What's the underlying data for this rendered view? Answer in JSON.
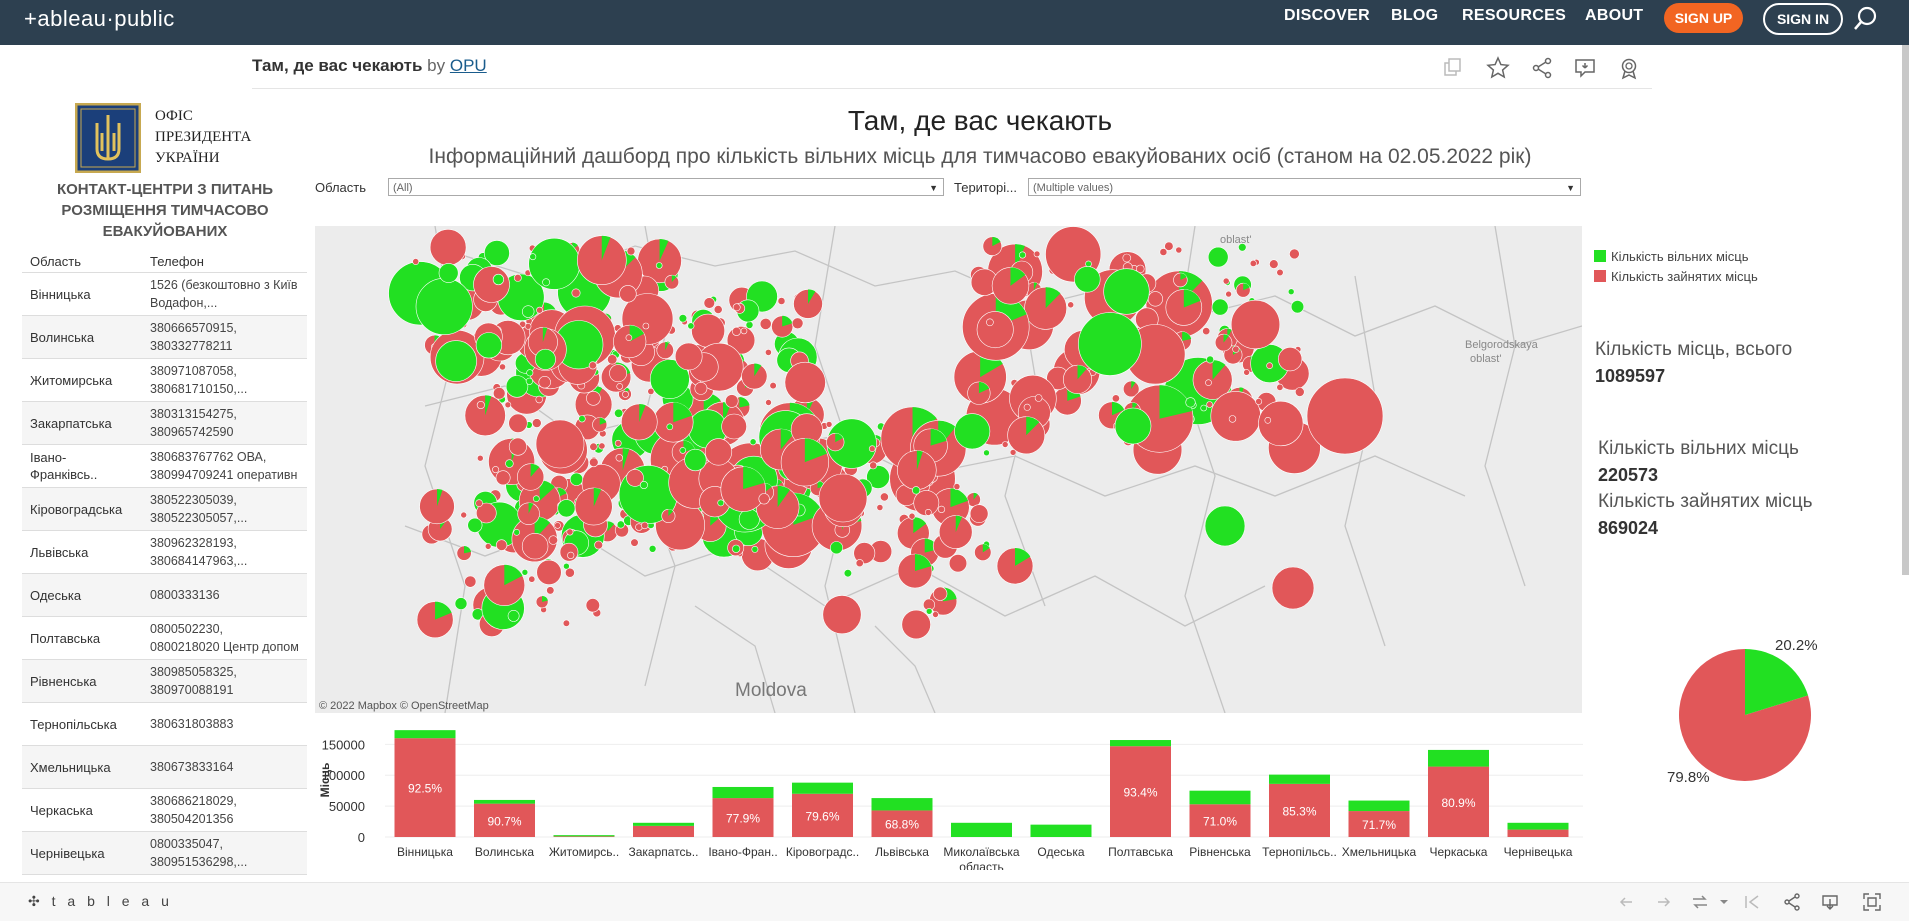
{
  "topbar": {
    "logo": "+ableau·public",
    "nav": [
      "DISCOVER",
      "BLOG",
      "RESOURCES",
      "ABOUT"
    ],
    "signup": "SIGN UP",
    "signin": "SIGN IN",
    "search_icon": "search-icon"
  },
  "viz": {
    "title": "Там, де вас чекають",
    "by": "by",
    "author": "OPU"
  },
  "toolbar_icons": [
    "copy-icon",
    "star-icon",
    "share-icon",
    "comment-icon",
    "badge-icon"
  ],
  "sidebar": {
    "org_lines": [
      "ОФІС",
      "ПРЕЗИДЕНТА",
      "УКРАЇНИ"
    ],
    "contact_title_lines": [
      "КОНТАКТ-ЦЕНТРИ З ПИТАНЬ",
      "РОЗМІЩЕННЯ ТИМЧАСОВО",
      "ЕВАКУЙОВАНИХ"
    ],
    "col_region": "Область",
    "col_phone": "Телефон",
    "rows": [
      {
        "region": "Вінницька",
        "phone": "1526 (безкоштовно з Київ\nВодафон,..."
      },
      {
        "region": "Волинська",
        "phone": "380666570915,\n380332778211"
      },
      {
        "region": "Житомирська",
        "phone": "380971087058,\n380681710150,..."
      },
      {
        "region": "Закарпатська",
        "phone": "380313154275,\n380965742590"
      },
      {
        "region": "Івано-\nФранківсь..",
        "phone": "380683767762 ОВА,\n380994709241 оперативн"
      },
      {
        "region": "Кіровоградська",
        "phone": "380522305039,\n380522305057,..."
      },
      {
        "region": "Львівська",
        "phone": "380962328193,\n380684147963,..."
      },
      {
        "region": "Одеська",
        "phone": "0800333136"
      },
      {
        "region": "Полтавська",
        "phone": "0800502230,\n0800218020 Центр допом"
      },
      {
        "region": "Рівненська",
        "phone": "380985058325,\n380970088191"
      },
      {
        "region": "Тернопільська",
        "phone": "380631803883"
      },
      {
        "region": "Хмельницька",
        "phone": "380673833164"
      },
      {
        "region": "Черкаська",
        "phone": "380686218029,\n380504201356"
      },
      {
        "region": "Чернівецька",
        "phone": "0800335047,\n380951536298,..."
      }
    ]
  },
  "dashboard": {
    "title": "Там, де вас чекають",
    "subtitle": "Інформаційний дашборд про кількість вільних місць для тимчасово евакуйованих осіб (станом на 02.05.2022 рік)",
    "filter1_label": "Область",
    "filter1_value": "(All)",
    "filter2_label": "Територі...",
    "filter2_value": "(Multiple values)"
  },
  "map": {
    "labels": [
      "oblast'",
      "Belgorodskaya\noblast'",
      "Moldova"
    ],
    "attribution": "© 2022 Mapbox  © OpenStreetMap",
    "colors": {
      "free": "#22e022",
      "occupied": "#e15759"
    }
  },
  "legend": {
    "free": "Кількість вільних місць",
    "occupied": "Кількість зайнятих місць"
  },
  "kpis": {
    "total_label": "Кількість місць,  всього",
    "total_value": "1089597",
    "free_label": "Кількість вільних місць",
    "free_value": "220573",
    "occupied_label": "Кількість зайнятих місць",
    "occupied_value": "869024"
  },
  "pie": {
    "free_pct_label": "20.2%",
    "occupied_pct_label": "79.8%",
    "free_pct": 20.2,
    "occupied_pct": 79.8
  },
  "chart_data": {
    "type": "bar",
    "stacked": true,
    "ylabel": "Місць",
    "yticks": [
      "150000",
      "100000",
      "50000",
      "0"
    ],
    "ylim": [
      0,
      170000
    ],
    "categories": [
      "Вінницька",
      "Волинська",
      "Житомирсь..",
      "Закарпатсь..",
      "Івано-Фран..",
      "Кіровоградс..",
      "Львівська",
      "Миколаївська\nобласть",
      "Одеська",
      "Полтавська",
      "Рівненська",
      "Тернопільсь..",
      "Хмельницька",
      "Черкаська",
      "Чернівецька"
    ],
    "series": [
      {
        "name": "Кількість зайнятих місць",
        "values": [
          160000,
          54000,
          1000,
          18000,
          63000,
          70000,
          43000,
          0,
          0,
          147000,
          53000,
          86000,
          42000,
          114000,
          12000
        ]
      },
      {
        "name": "Кількість вільних місць",
        "values": [
          13000,
          6000,
          2000,
          5000,
          18000,
          18000,
          20000,
          23000,
          20000,
          10000,
          22000,
          15000,
          17000,
          27000,
          11000
        ]
      }
    ],
    "data_labels": [
      "92.5%",
      "90.7%",
      "",
      "",
      "77.9%",
      "79.6%",
      "68.8%",
      "",
      "",
      "93.4%",
      "71.0%",
      "85.3%",
      "71.7%",
      "80.9%",
      ""
    ]
  },
  "footer": {
    "logo": "✣ t a b l e a u"
  }
}
